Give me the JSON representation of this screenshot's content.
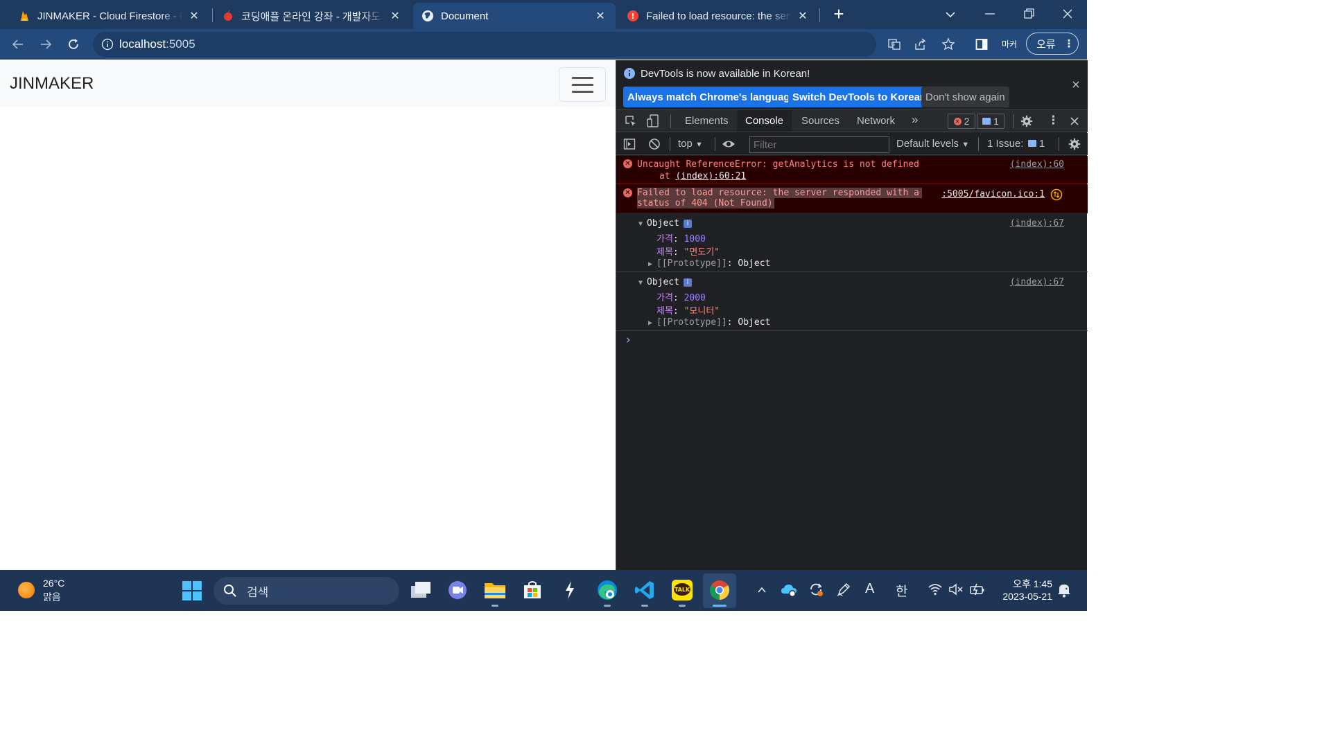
{
  "browser": {
    "tabs": [
      {
        "title": "JINMAKER - Cloud Firestore - Fi",
        "active": false
      },
      {
        "title": "코딩애플 온라인 강좌 - 개발자도",
        "active": false
      },
      {
        "title": "Document",
        "active": true
      },
      {
        "title": "Failed to load resource: the serv",
        "active": false
      }
    ],
    "new_tab": "+",
    "address_host": "localhost",
    "address_port": ":5005",
    "profile_label": "마커",
    "error_badge": "오류"
  },
  "page": {
    "brand": "JINMAKER"
  },
  "devtools": {
    "infobar": {
      "message": "DevTools is now available in Korean!",
      "btn_match": "Always match Chrome's language",
      "btn_switch": "Switch DevTools to Korean",
      "btn_dont": "Don't show again"
    },
    "tabs": [
      "Elements",
      "Console",
      "Sources",
      "Network"
    ],
    "active_tab": "Console",
    "error_count": "2",
    "message_count": "1",
    "console_toolbar": {
      "context": "top",
      "filter_placeholder": "Filter",
      "levels": "Default levels",
      "issues_label": "1 Issue:",
      "issues_count": "1"
    },
    "messages": {
      "err1_text": "Uncaught ReferenceError: getAnalytics is not defined",
      "err1_at": "at ",
      "err1_link": "(index):60:21",
      "err1_src": "(index):60",
      "err2_line1": "Failed to load resource: the server responded with a",
      "err2_line2": "status of 404 (Not Found)",
      "err2_src": ":5005/favicon.ico:1",
      "obj1": {
        "label": "Object",
        "price_key": "가격",
        "price": "1000",
        "title_key": "제목",
        "title": "\"면도기\"",
        "proto": "[[Prototype]]",
        "proto_val": "Object",
        "src": "(index):67"
      },
      "obj2": {
        "label": "Object",
        "price_key": "가격",
        "price": "2000",
        "title_key": "제목",
        "title": "\"모니터\"",
        "proto": "[[Prototype]]",
        "proto_val": "Object",
        "src": "(index):67"
      },
      "prompt": "›"
    }
  },
  "taskbar": {
    "weather_temp": "26°C",
    "weather_desc": "맑음",
    "search_placeholder": "검색",
    "ime_mode": "A",
    "ime_lang": "한",
    "time": "오후 1:45",
    "date": "2023-05-21"
  },
  "colors": {
    "error_bg": "#290000",
    "error_text": "#ff8080",
    "accent": "#1a73e8",
    "chrome_frame": "#1e3a5f"
  }
}
